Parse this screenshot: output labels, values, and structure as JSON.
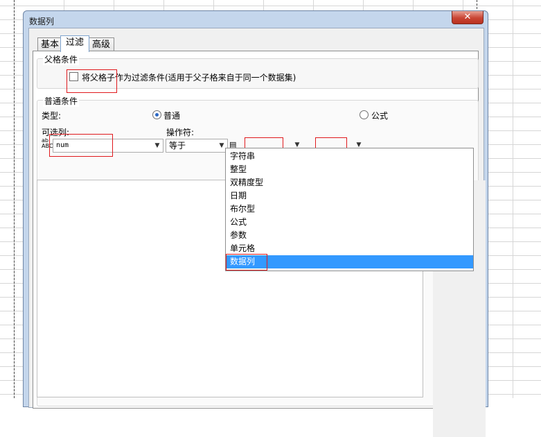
{
  "window": {
    "title": "数据列",
    "close_glyph": "✕"
  },
  "tabs": [
    {
      "label": "基本"
    },
    {
      "label": "过滤"
    },
    {
      "label": "高级"
    }
  ],
  "parent_condition": {
    "group_label": "父格条件",
    "checkbox_label": "将父格子作为过滤条件(适用于父子格来自于同一个数据集)",
    "checked": false
  },
  "normal_condition": {
    "group_label": "普通条件",
    "type_label": "类型:",
    "type_options": [
      {
        "label": "普通",
        "selected": true
      },
      {
        "label": "公式",
        "selected": false
      }
    ],
    "column_label": "可选列:",
    "column_value": "num",
    "operator_label": "操作符:",
    "operator_value": "等于",
    "value_type_value": "",
    "value_value": ""
  },
  "value_type_menu": {
    "items": [
      "字符串",
      "整型",
      "双精度型",
      "日期",
      "布尔型",
      "公式",
      "参数",
      "单元格",
      "数据列"
    ],
    "selected": "数据列"
  },
  "colors": {
    "selection": "#3399ff",
    "highlight_box": "#e0191d",
    "close_button": "#c94534"
  }
}
